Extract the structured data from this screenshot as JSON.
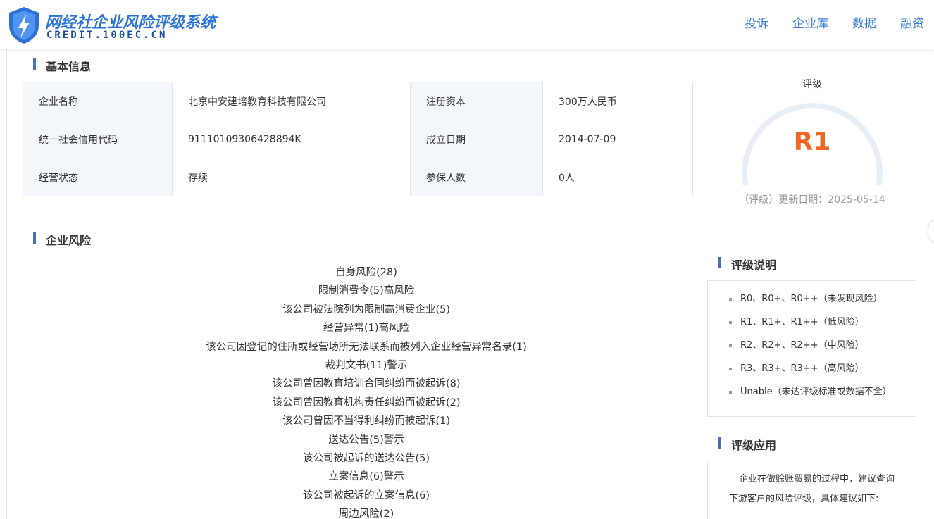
{
  "header": {
    "logo_title": "网经社企业风险评级系统",
    "logo_sub": "CREDIT.100EC.CN",
    "nav": [
      "投诉",
      "企业库",
      "数据",
      "融资"
    ]
  },
  "basic": {
    "title": "基本信息",
    "rows": [
      {
        "l1": "企业名称",
        "v1": "北京中安建培教育科技有限公司",
        "l2": "注册资本",
        "v2": "300万人民币"
      },
      {
        "l1": "统一社会信用代码",
        "v1": "91110109306428894K",
        "l2": "成立日期",
        "v2": "2014-07-09"
      },
      {
        "l1": "经营状态",
        "v1": "存续",
        "l2": "参保人数",
        "v2": "0人"
      }
    ]
  },
  "rating": {
    "label": "评级",
    "value": "R1",
    "date": "（评级）更新日期：2025-05-14"
  },
  "risk": {
    "title": "企业风险",
    "items": [
      "自身风险(28)",
      "限制消费令(5)高风险",
      "该公司被法院列为限制高消费企业(5)",
      "经营异常(1)高风险",
      "该公司因登记的住所或经营场所无法联系而被列入企业经营异常名录(1)",
      "裁判文书(11)警示",
      "该公司曾因教育培训合同纠纷而被起诉(8)",
      "该公司曾因教育机构责任纠纷而被起诉(2)",
      "该公司曾因不当得利纠纷而被起诉(1)",
      "送达公告(5)警示",
      "该公司被起诉的送达公告(5)",
      "立案信息(6)警示",
      "该公司被起诉的立案信息(6)",
      "周边风险(2)"
    ]
  },
  "explain": {
    "title": "评级说明",
    "items": [
      "R0、R0+、R0++（未发现风险）",
      "R1、R1+、R1++（低风险）",
      "R2、R2+、R2++（中风险）",
      "R3、R3+、R3++（高风险）",
      "Unable（未达评级标准或数据不全）"
    ]
  },
  "application": {
    "title": "评级应用",
    "text": "企业在做赊账贸易的过程中，建议查询下游客户的风险评级，具体建议如下:"
  }
}
